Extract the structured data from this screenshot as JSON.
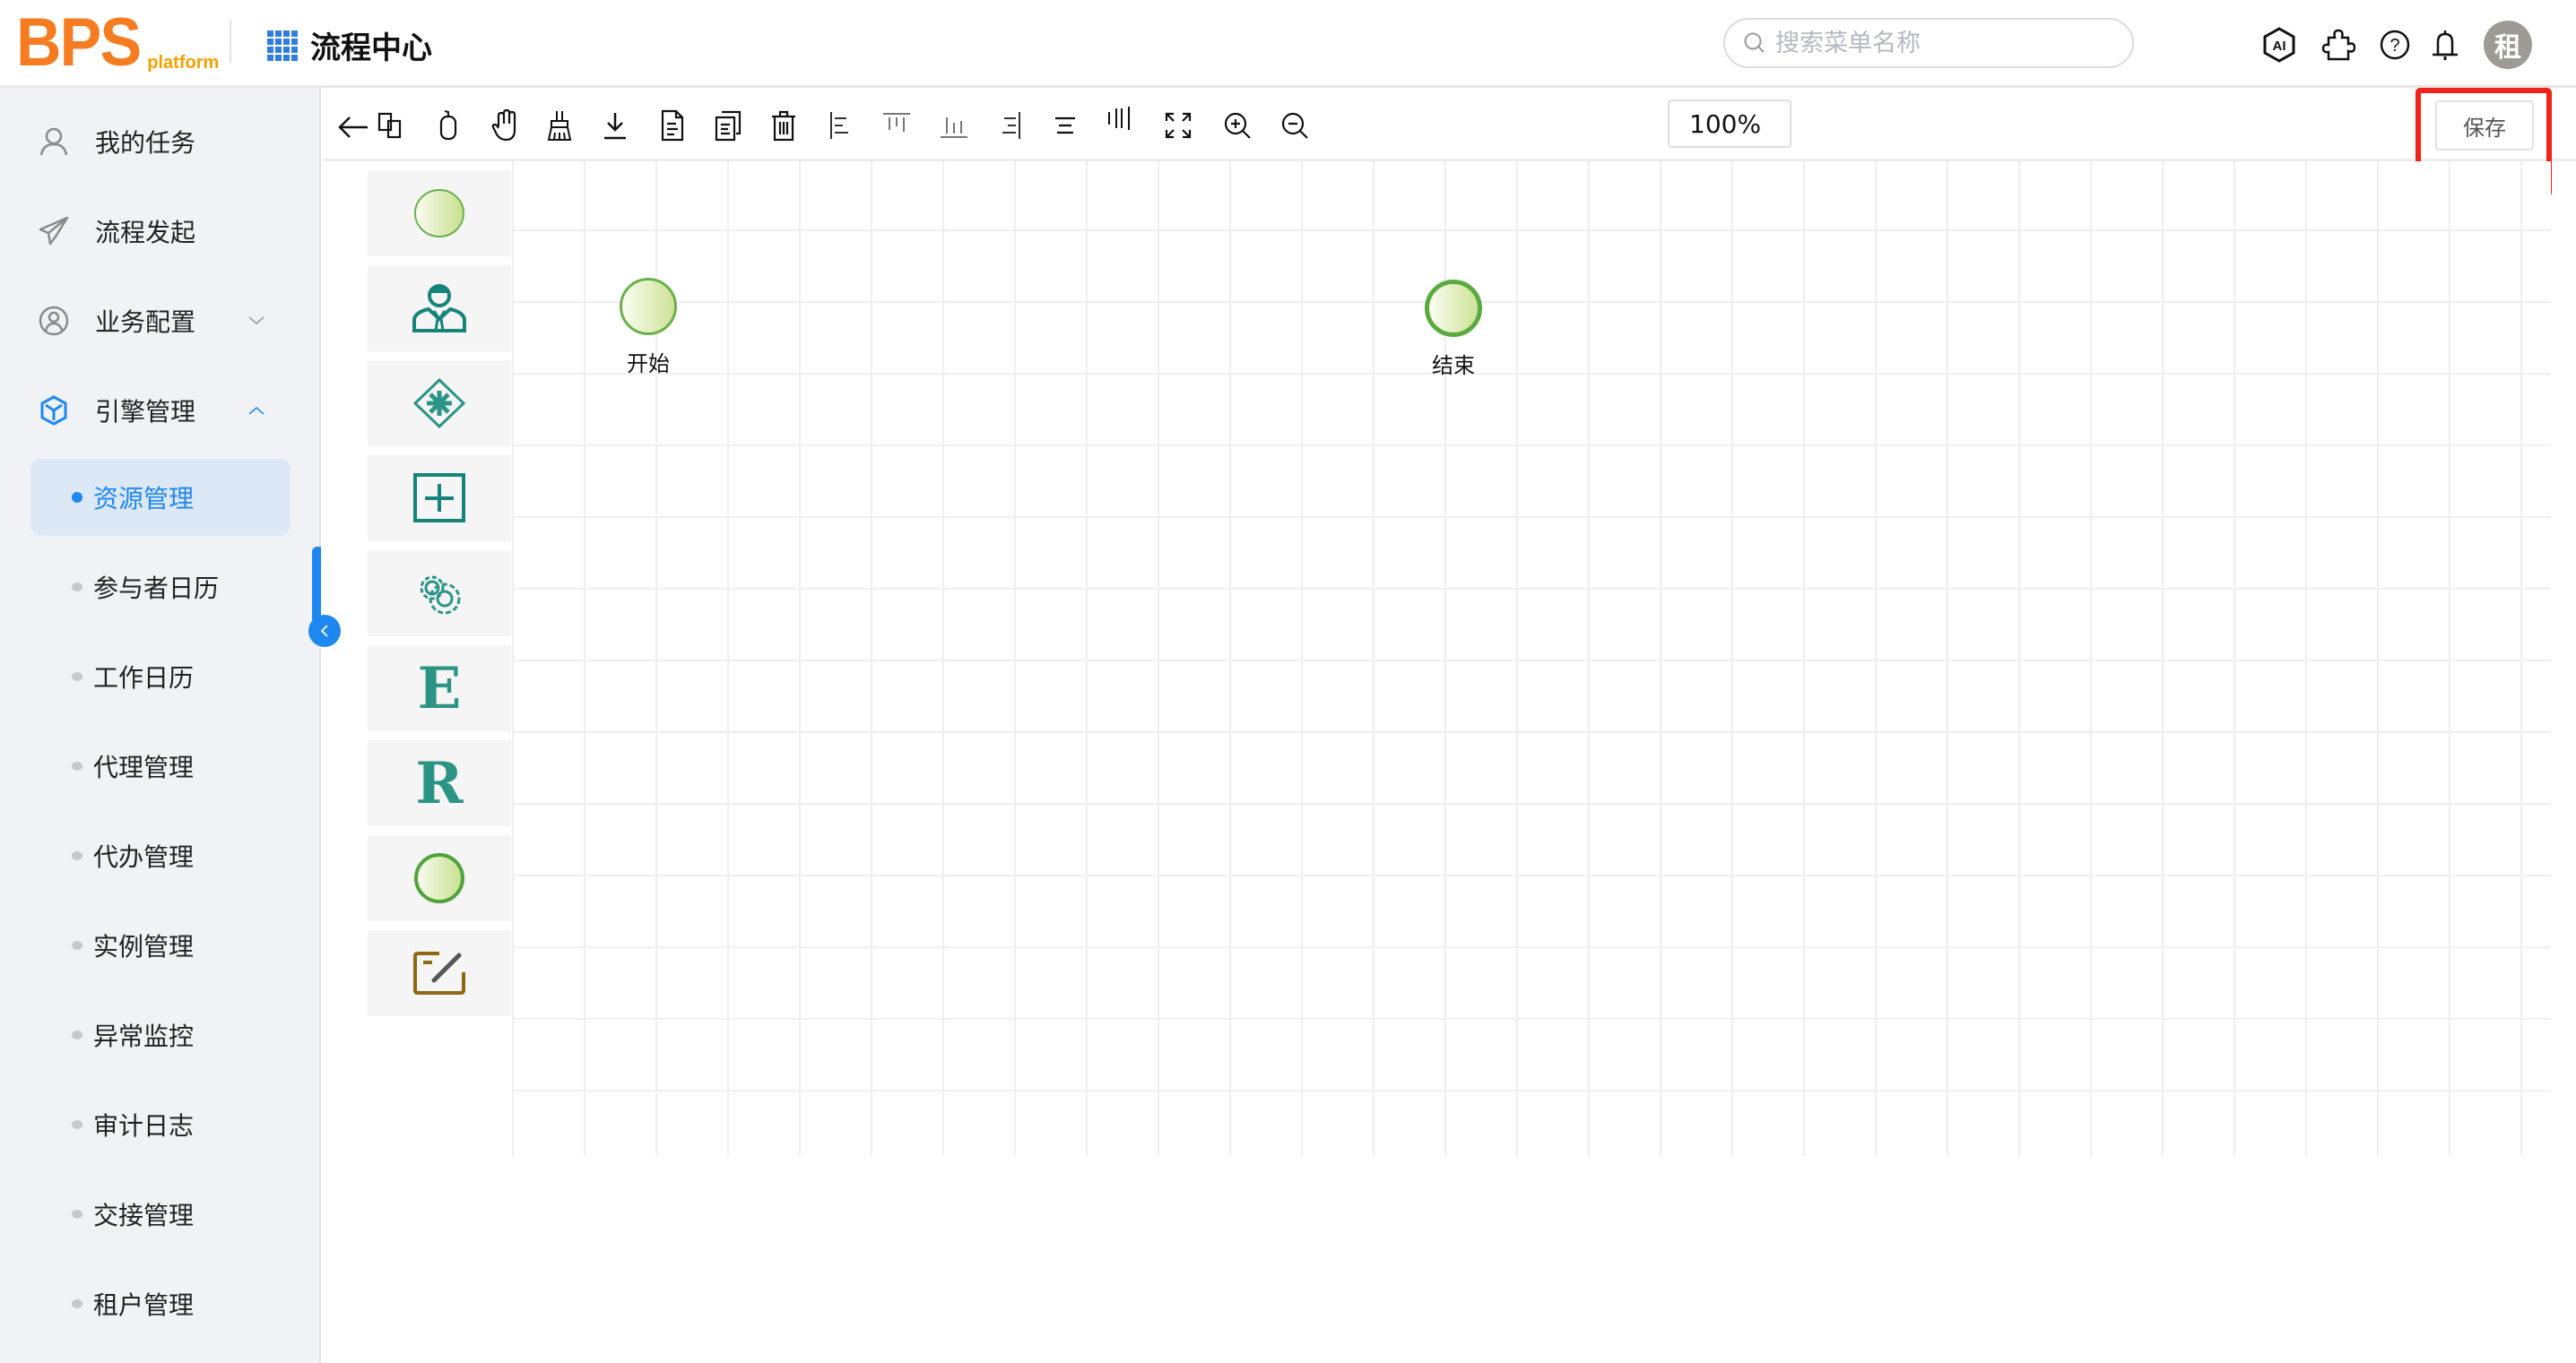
{
  "header": {
    "logo_main": "BPS",
    "logo_sub": "platform",
    "app_title": "流程中心",
    "search_placeholder": "搜索菜单名称",
    "search_value": "",
    "icons": [
      "ai-icon",
      "plugin-icon",
      "help-icon",
      "bell-icon"
    ],
    "avatar_text": "租"
  },
  "sidebar": {
    "items": [
      {
        "label": "我的任务",
        "icon": "user-icon"
      },
      {
        "label": "流程发起",
        "icon": "paper-plane-icon"
      },
      {
        "label": "业务配置",
        "icon": "user-circle-icon",
        "expanded": false
      },
      {
        "label": "引擎管理",
        "icon": "cube-icon",
        "expanded": true
      }
    ],
    "sub_items": [
      {
        "label": "资源管理",
        "active": true
      },
      {
        "label": "参与者日历"
      },
      {
        "label": "工作日历"
      },
      {
        "label": "代理管理"
      },
      {
        "label": "代办管理"
      },
      {
        "label": "实例管理"
      },
      {
        "label": "异常监控"
      },
      {
        "label": "审计日志"
      },
      {
        "label": "交接管理"
      },
      {
        "label": "租户管理"
      }
    ],
    "accent_color": "#1e88f0"
  },
  "toolbar": {
    "buttons": [
      "back",
      "copy",
      "mouse",
      "hand",
      "clean",
      "download",
      "document",
      "documents",
      "delete",
      "align-left",
      "align-top",
      "align-bottom",
      "align-right",
      "align-center-horizontal",
      "align-center-vertical",
      "fit-screen",
      "zoom-in",
      "zoom-out"
    ],
    "zoom_level": "100%",
    "save_label": "保存"
  },
  "palette": {
    "items": [
      "start-event",
      "user-task",
      "gateway",
      "sub-process",
      "service-task",
      "E",
      "R",
      "end-event",
      "annotation"
    ],
    "letters": {
      "e": "E",
      "r": "R"
    }
  },
  "canvas": {
    "nodes": [
      {
        "id": "start",
        "label": "开始",
        "type": "start-event"
      },
      {
        "id": "end",
        "label": "结束",
        "type": "end-event"
      }
    ]
  }
}
